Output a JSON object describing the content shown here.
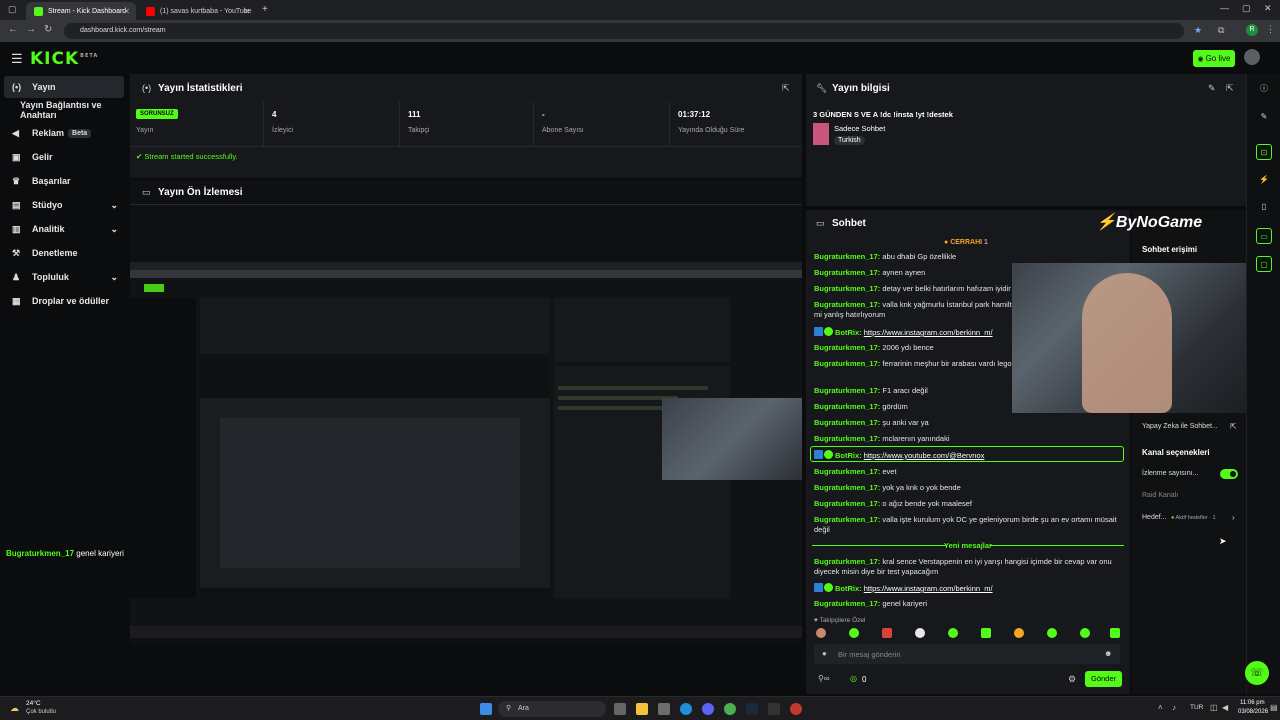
{
  "browser": {
    "tabs": [
      {
        "label": "Stream - Kick Dashboard",
        "active": true
      },
      {
        "label": "(1) savas kurtbaba - YouTube",
        "active": false
      }
    ],
    "url": "dashboard.kick.com/stream",
    "profile_initial": "R"
  },
  "header": {
    "logo": "KICK",
    "logo_badge": "BETA",
    "go_live": "Go live"
  },
  "sidebar": {
    "items": [
      {
        "label": "Yayın",
        "icon": "broadcast-icon"
      },
      {
        "label": "Yayın Bağlantısı ve Anahtarı"
      },
      {
        "label": "Reklam",
        "badge": "Beta",
        "icon": "megaphone-icon"
      },
      {
        "label": "Gelir",
        "icon": "wallet-icon"
      },
      {
        "label": "Başarılar",
        "icon": "trophy-icon"
      },
      {
        "label": "Stüdyo",
        "icon": "studio-icon"
      },
      {
        "label": "Analitik",
        "icon": "chart-icon"
      },
      {
        "label": "Denetleme",
        "icon": "hammer-icon"
      },
      {
        "label": "Topluluk",
        "icon": "users-icon"
      },
      {
        "label": "Droplar ve ödüller",
        "icon": "gift-icon"
      }
    ],
    "overlay_text_user": "Bugraturkmen_17",
    "overlay_text_msg": "genel kariyeri"
  },
  "stats": {
    "title": "Yayın İstatistikleri",
    "status_badge": "SORUNSUZ",
    "cells": [
      {
        "value": "",
        "label": "Yayın"
      },
      {
        "value": "4",
        "label": "İzleyici"
      },
      {
        "value": "111",
        "label": "Takipçi"
      },
      {
        "value": "-",
        "label": "Abone Sayısı"
      },
      {
        "value": "01:37:12",
        "label": "Yayında Olduğu Süre"
      }
    ],
    "success_msg": "Stream started successfully."
  },
  "preview": {
    "title": "Yayın Ön İzlemesi"
  },
  "info": {
    "title": "Yayın bilgisi",
    "stream_title": "3 GÜNDEN S VE A !dc !insta !yt !destek",
    "category": "Sadece Sohbet",
    "language": "Turkish"
  },
  "chat": {
    "title": "Sohbet",
    "pinned": "CERRAHI",
    "pinned_count": "1",
    "messages": [
      {
        "user": "Bugraturkmen_17",
        "text": "abu dhabi Gp özellikle"
      },
      {
        "user": "Bugraturkmen_17",
        "text": "aynen aynen"
      },
      {
        "user": "Bugraturkmen_17",
        "text": "detay ver belki hatırlarım hafızam iyidir"
      },
      {
        "user": "Bugraturkmen_17",
        "text": "valla knk yağmurlu İstanbul park hamilton sadece 2006 geldi aklıma ben mi yanlış hatırlıyorum"
      },
      {
        "user": "BotRix",
        "text": "https://www.instagram.com/berkinn_m/",
        "bot": true
      },
      {
        "user": "Bugraturkmen_17",
        "text": "2006 ydı bence"
      },
      {
        "user": "Bugraturkmen_17",
        "text": "ferrarinin meşhur bir arabası vardı legoso bayılıyorum"
      },
      {
        "user": "Bugraturkmen_17",
        "text": "F1 aracı değil"
      },
      {
        "user": "Bugraturkmen_17",
        "text": "gördüm"
      },
      {
        "user": "Bugraturkmen_17",
        "text": "şu anki var ya"
      },
      {
        "user": "Bugraturkmen_17",
        "text": "mclarenın yanındaki"
      },
      {
        "user": "BotRix",
        "text": "https://www.youtube.com/@Bervnox",
        "bot": true
      },
      {
        "user": "Bugraturkmen_17",
        "text": "evet"
      },
      {
        "user": "Bugraturkmen_17",
        "text": "yok ya knk o yok bende"
      },
      {
        "user": "Bugraturkmen_17",
        "text": "o ağız bende yok maalesef"
      },
      {
        "user": "Bugraturkmen_17",
        "text": "valla işte kurulum yok DC ye geleniyorum birde şu an ev ortamı müsait değil"
      }
    ],
    "new_messages_label": "Yeni mesajlar",
    "new_messages": [
      {
        "user": "Bugraturkmen_17",
        "text": "kral sence Verstappenin en iyi yarışı hangisi içimde bir cevap var onu diyecek misin diye bir test yapacağım"
      },
      {
        "user": "BotRix",
        "text": "https://www.instagram.com/berkinn_m/",
        "bot": true
      },
      {
        "user": "Bugraturkmen_17",
        "text": "genel kariyeri"
      }
    ],
    "emote_row_label": "Takipçilere Özel",
    "input_placeholder": "Bir mesaj gönderin",
    "points": "0",
    "send": "Gönder"
  },
  "settings": {
    "brand_overlay": "ByNoGame",
    "chat_access": "Sohbet erişimi",
    "ai_chat": "Yapay Zeka ile Sohbet...",
    "channel_options": "Kanal seçenekleri",
    "viewer_count": "İzlenme sayısını...",
    "raid_channel": "Raid Kanalı",
    "targets": "Hedef...",
    "active_targets": "Aktif hedefler · 1"
  },
  "taskbar": {
    "weather_temp": "24°C",
    "weather_desc": "Çok bulutlu",
    "search": "Ara",
    "lang": "TUR",
    "time": "11:06 pm",
    "date": "03/08/2026"
  },
  "colors": {
    "accent": "#53fc18",
    "panel": "#16181b",
    "bg": "#0b0c0e"
  }
}
